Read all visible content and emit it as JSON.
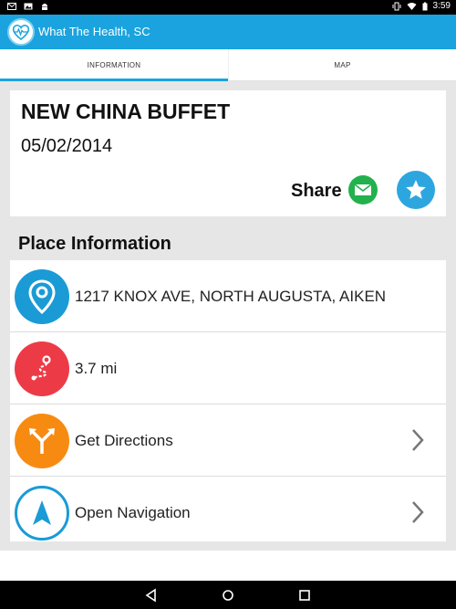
{
  "status_bar": {
    "time": "3:59",
    "left_icons": [
      "gmail-icon",
      "photo-icon",
      "android-icon"
    ],
    "right_icons": [
      "vibrate-icon",
      "wifi-icon",
      "battery-icon"
    ]
  },
  "app_bar": {
    "title": "What The Health, SC",
    "logo_icon": "heart-pulse-icon"
  },
  "tabs": [
    {
      "label": "INFORMATION",
      "selected": true
    },
    {
      "label": "MAP",
      "selected": false
    }
  ],
  "place": {
    "name": "NEW CHINA BUFFET",
    "date": "05/02/2014",
    "share_label": "Share",
    "share_icon": "mail-icon",
    "favorite_icon": "star-icon"
  },
  "section_title": "Place Information",
  "info_rows": [
    {
      "text": "1217 KNOX AVE, NORTH AUGUSTA, AIKEN",
      "icon": "location-pin-icon",
      "color": "#1a9bd6",
      "has_chevron": false
    },
    {
      "text": "3.7 mi",
      "icon": "route-distance-icon",
      "color": "#ec3b47",
      "has_chevron": false
    },
    {
      "text": "Get Directions",
      "icon": "directions-split-icon",
      "color": "#f78b12",
      "has_chevron": true
    },
    {
      "text": "Open Navigation",
      "icon": "navigation-arrow-icon",
      "color": "#1a9bd6",
      "has_chevron": true
    }
  ],
  "colors": {
    "accent": "#1aa3de",
    "mail_green": "#22b14c",
    "favorite_blue": "#2da6df"
  },
  "nav_bar": {
    "buttons": [
      "back-icon",
      "home-icon",
      "recents-icon"
    ]
  }
}
